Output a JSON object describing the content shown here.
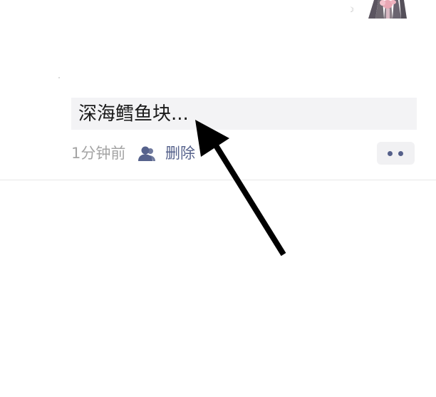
{
  "header": {
    "partial_image_icon": "cropped-avatar-image",
    "small_glyph": "☽"
  },
  "comment": {
    "text": "深海鳕鱼块...",
    "time_ago": "1分钟前",
    "delete_label": "删除",
    "privacy_icon": "user-icon",
    "more_icon": "more-dots-icon"
  },
  "colors": {
    "link": "#56628c",
    "muted": "#a4a4a4",
    "bubble_bg": "#f3f3f5",
    "text": "#1a1a1a"
  },
  "annotation": {
    "icon": "black-arrow-pointer"
  }
}
